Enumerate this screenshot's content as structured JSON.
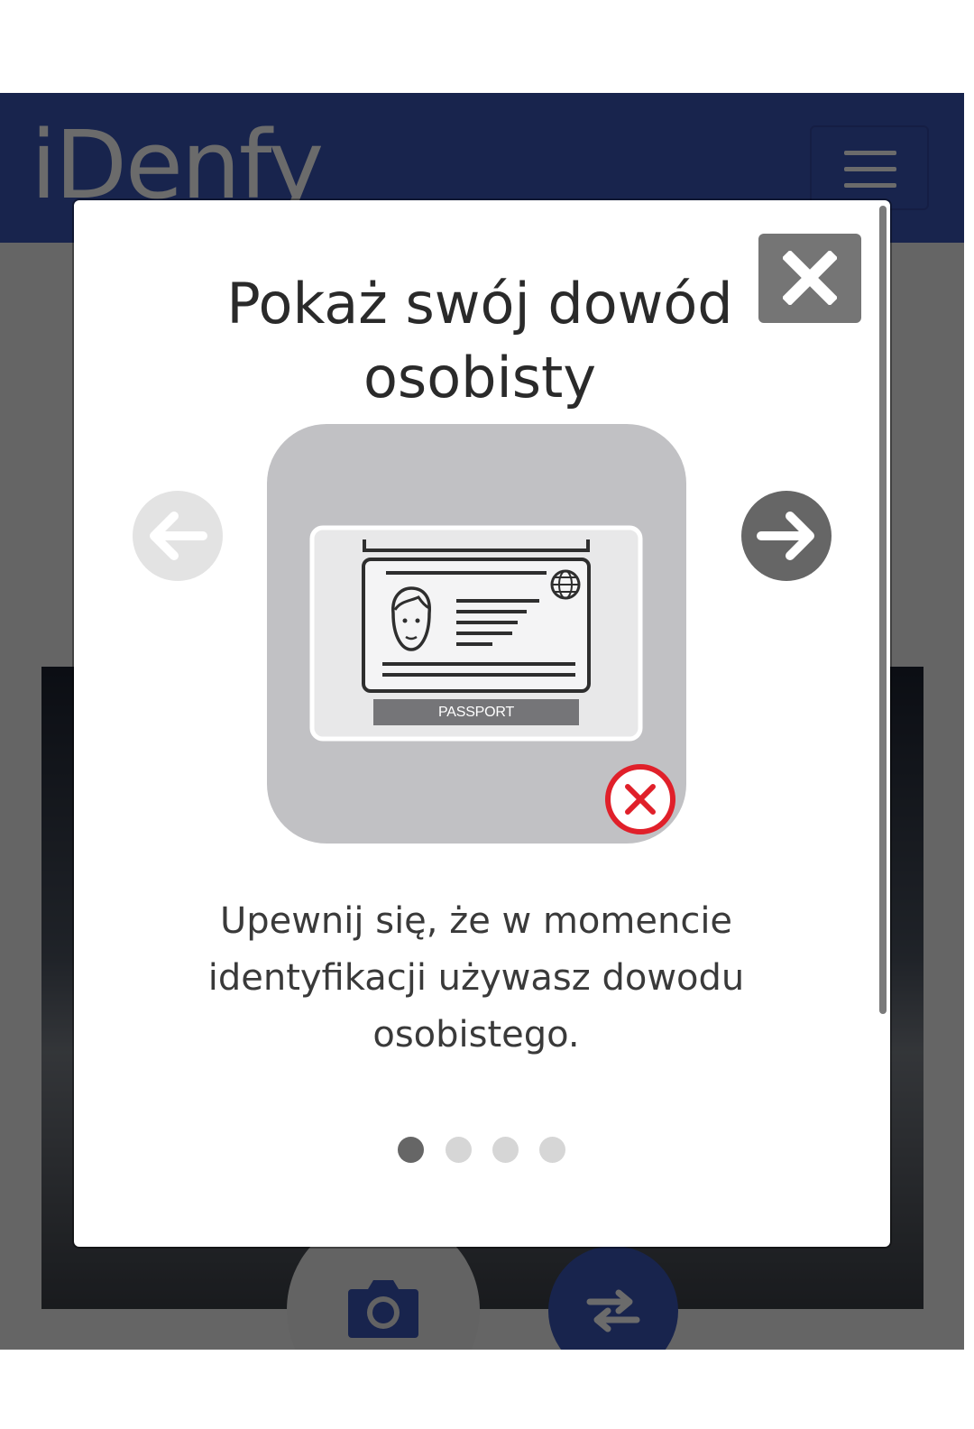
{
  "app": {
    "logo_text": "iDenfy",
    "brand_color": "#3a56b8",
    "menu_icon": "hamburger-menu-icon",
    "camera_icon": "camera-icon",
    "switch_icon": "switch-camera-icon"
  },
  "modal": {
    "title": "Pokaż swój dowód osobisty",
    "close_icon": "close-icon",
    "illustration": {
      "card_label": "PASSPORT",
      "status_icon": "invalid-x-icon",
      "status_color": "#e0202a"
    },
    "prev_icon": "arrow-left-icon",
    "next_icon": "arrow-right-icon",
    "description": "Upewnij się, że w momencie identyfikacji używasz dowodu osobistego.",
    "pagination": {
      "total": 4,
      "active_index": 0,
      "active_color": "#666666",
      "inactive_color": "#d6d6d6"
    }
  }
}
